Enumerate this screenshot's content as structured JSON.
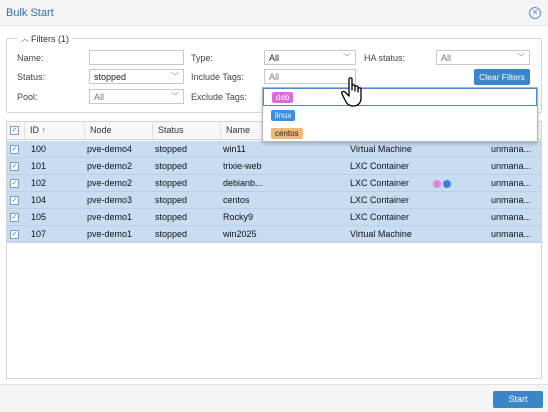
{
  "window": {
    "title": "Bulk Start"
  },
  "filters": {
    "legend": "Filters (1)",
    "name_label": "Name:",
    "name_value": "",
    "type_label": "Type:",
    "type_value": "All",
    "ha_label": "HA status:",
    "ha_value": "All",
    "status_label": "Status:",
    "status_value": "stopped",
    "include_label": "Include Tags:",
    "include_value": "All",
    "clear_label": "Clear Filters",
    "pool_label": "Pool:",
    "pool_value": "All",
    "exclude_label": "Exclude Tags:"
  },
  "tag_options": [
    {
      "label": "deb",
      "color": "#e06ad8"
    },
    {
      "label": "linux",
      "color": "#3b8fe0"
    },
    {
      "label": "centos",
      "color": "#f0b878"
    }
  ],
  "columns": {
    "id": "ID",
    "node": "Node",
    "status": "Status",
    "name": "Name"
  },
  "sort_indicator": "↑",
  "rows": [
    {
      "id": "100",
      "node": "pve-demo4",
      "status": "stopped",
      "name": "win11",
      "type": "Virtual Machine",
      "ha": "unmana...",
      "dots": []
    },
    {
      "id": "101",
      "node": "pve-demo2",
      "status": "stopped",
      "name": "trixie-web",
      "type": "LXC Container",
      "ha": "unmana...",
      "dots": []
    },
    {
      "id": "102",
      "node": "pve-demo2",
      "status": "stopped",
      "name": "debianb...",
      "type": "LXC Container",
      "ha": "unmana...",
      "dots": [
        "#e57fe0",
        "#3b82e0"
      ]
    },
    {
      "id": "104",
      "node": "pve-demo3",
      "status": "stopped",
      "name": "centos",
      "type": "LXC Container",
      "ha": "unmana...",
      "dots": []
    },
    {
      "id": "105",
      "node": "pve-demo1",
      "status": "stopped",
      "name": "Rocky9",
      "type": "LXC Container",
      "ha": "unmana...",
      "dots": []
    },
    {
      "id": "107",
      "node": "pve-demo1",
      "status": "stopped",
      "name": "win2025",
      "type": "Virtual Machine",
      "ha": "unmana...",
      "dots": []
    }
  ],
  "footer": {
    "start_label": "Start"
  },
  "colors": {
    "accent": "#3a86c8",
    "row_selected": "#c8dcf2",
    "title": "#2f6fb5"
  }
}
